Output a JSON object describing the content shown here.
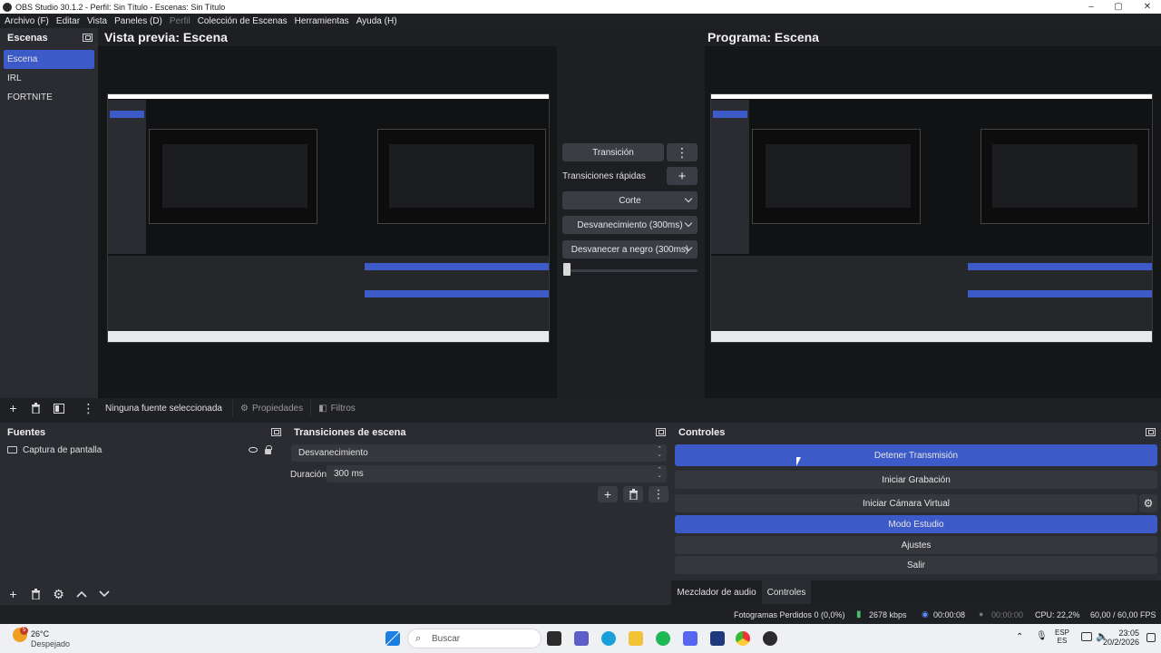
{
  "window": {
    "title": "OBS Studio 30.1.2 - Perfil: Sin Título - Escenas: Sin Título",
    "controls": [
      "–",
      "▢",
      "✕"
    ]
  },
  "menu": [
    "Archivo (F)",
    "Editar",
    "Vista",
    "Paneles (D)",
    "Perfil",
    "Colección de Escenas",
    "Herramientas",
    "Ayuda (H)"
  ],
  "scenes": {
    "title": "Escenas",
    "items": [
      "Escena",
      "IRL",
      "FORTNITE"
    ],
    "selected": "Escena"
  },
  "preview": {
    "title": "Vista previa: Escena"
  },
  "program": {
    "title": "Programa: Escena"
  },
  "transition_panel": {
    "transition_button": "Transición",
    "quick_label": "Transiciones rápidas",
    "quick_items": [
      "Corte",
      "Desvanecimiento (300ms)",
      "Desvanecer a negro (300ms)"
    ],
    "tbar_position": 0.0
  },
  "source_toolbar": {
    "status": "Ninguna fuente seleccionada",
    "properties": "Propiedades",
    "filters": "Filtros"
  },
  "sources": {
    "title": "Fuentes",
    "items": [
      {
        "name": "Captura de pantalla",
        "visible": true,
        "locked": false
      }
    ]
  },
  "scene_transitions": {
    "title": "Transiciones de escena",
    "selected": "Desvanecimiento",
    "duration_label": "Duración",
    "duration_value": "300 ms"
  },
  "controls": {
    "title": "Controles",
    "stop_stream": "Detener Transmisión",
    "start_recording": "Iniciar Grabación",
    "start_virtual_cam": "Iniciar Cámara Virtual",
    "studio_mode": "Modo Estudio",
    "settings": "Ajustes",
    "exit": "Salir"
  },
  "bottom_tabs": [
    "Mezclador de audio",
    "Controles"
  ],
  "active_bottom_tab": "Controles",
  "status": {
    "dropped_frames": "Fotogramas Perdidos 0 (0,0%)",
    "bitrate": "2678 kbps",
    "stream_time": "00:00:08",
    "rec_time": "00:00:00",
    "cpu": "CPU: 22,2%",
    "fps": "60,00 / 60,00 FPS"
  },
  "taskbar": {
    "weather_temp": "26°C",
    "weather_desc": "Despejado",
    "weather_badge": "5",
    "search_placeholder": "Buscar",
    "lang_top": "ESP",
    "lang_bottom": "ES",
    "time": "23:05",
    "date": "20/2/2026"
  },
  "colors": {
    "accent": "#3c5bc8",
    "panel": "#2a2c31",
    "background": "#1e1f22"
  }
}
